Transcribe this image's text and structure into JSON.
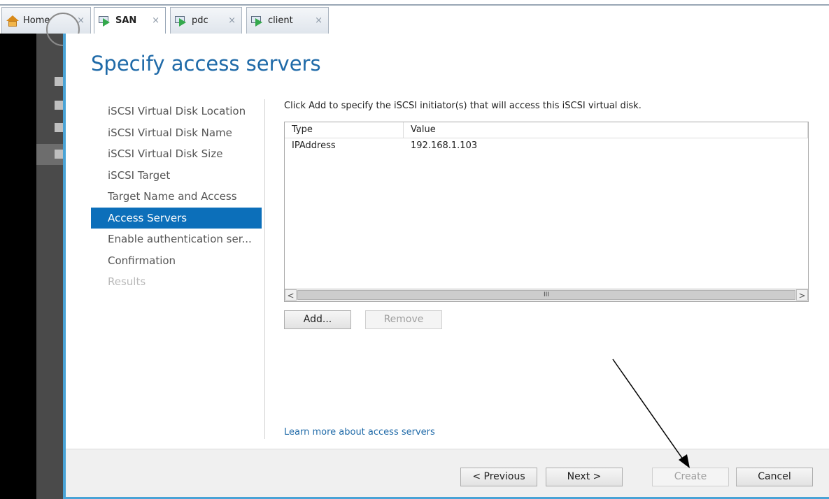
{
  "tabs": [
    {
      "label": "Home",
      "icon": "home-icon",
      "active": false
    },
    {
      "label": "SAN",
      "icon": "vm-icon",
      "active": true
    },
    {
      "label": "pdc",
      "icon": "vm-icon",
      "active": false
    },
    {
      "label": "client",
      "icon": "vm-icon",
      "active": false
    }
  ],
  "tab_close_glyph": "×",
  "wizard": {
    "title": "Specify access servers",
    "nav": [
      {
        "label": "iSCSI Virtual Disk Location",
        "state": "normal"
      },
      {
        "label": "iSCSI Virtual Disk Name",
        "state": "normal"
      },
      {
        "label": "iSCSI Virtual Disk Size",
        "state": "normal"
      },
      {
        "label": "iSCSI Target",
        "state": "normal"
      },
      {
        "label": "Target Name and Access",
        "state": "normal"
      },
      {
        "label": "Access Servers",
        "state": "active"
      },
      {
        "label": "Enable authentication ser...",
        "state": "normal"
      },
      {
        "label": "Confirmation",
        "state": "normal"
      },
      {
        "label": "Results",
        "state": "disabled"
      }
    ],
    "instruction": "Click Add to specify the iSCSI initiator(s) that will access this iSCSI virtual disk.",
    "table": {
      "headers": [
        "Type",
        "Value"
      ],
      "rows": [
        [
          "IPAddress",
          "192.168.1.103"
        ]
      ]
    },
    "scroll": {
      "left": "<",
      "right": ">",
      "thumb": "III"
    },
    "add_button": "Add...",
    "remove_button": "Remove",
    "learn_link": "Learn more about access servers",
    "footer": {
      "previous": "< Previous",
      "next": "Next >",
      "create": "Create",
      "cancel": "Cancel"
    }
  },
  "colors": {
    "accent": "#0c6fba",
    "title": "#1f6aa8",
    "frame": "#49a3d6"
  }
}
